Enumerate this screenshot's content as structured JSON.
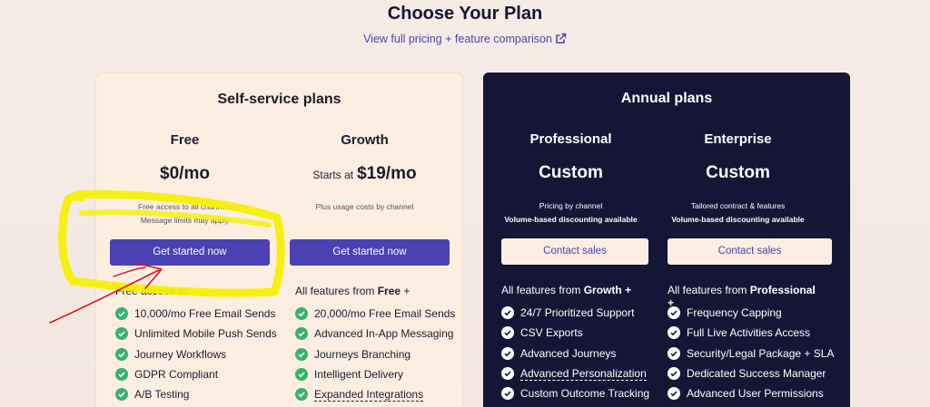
{
  "header": {
    "title": "Choose Your Plan",
    "compare_link": "View full pricing + feature comparison",
    "compare_icon": "external-link-icon"
  },
  "self_service": {
    "title": "Self-service plans",
    "plans": [
      {
        "name": "Free",
        "price_prefix": "",
        "price": "$0/mo",
        "desc_line1": "Free access to all channels",
        "desc_line2": "Message limits may apply",
        "button": "Get started now",
        "features_head_text": "Free access to:",
        "features_head_bold": "",
        "features": [
          "10,000/mo Free Email Sends",
          "Unlimited Mobile Push Sends",
          "Journey Workflows",
          "GDPR Compliant",
          "A/B Testing"
        ]
      },
      {
        "name": "Growth",
        "price_prefix": "Starts at",
        "price": "$19/mo",
        "desc_line1": "Plus usage costs by channel",
        "desc_line2": "",
        "button": "Get started now",
        "features_head_text": "All features from",
        "features_head_bold": "Free",
        "features_head_suffix": "+",
        "features": [
          "20,000/mo Free Email Sends",
          "Advanced In-App Messaging",
          "Journeys Branching",
          "Intelligent Delivery",
          "Expanded Integrations"
        ]
      }
    ]
  },
  "annual": {
    "title": "Annual plans",
    "plans": [
      {
        "name": "Professional",
        "price": "Custom",
        "desc_line1": "Pricing by channel",
        "desc_line2": "Volume-based discounting available",
        "button": "Contact sales",
        "features_head_text": "All features from",
        "features_head_bold": "Growth",
        "features_head_suffix": "+",
        "features": [
          "24/7 Prioritized Support",
          "CSV Exports",
          "Advanced Journeys",
          "Advanced Personalization",
          "Custom Outcome Tracking"
        ]
      },
      {
        "name": "Enterprise",
        "price": "Custom",
        "desc_line1": "Tailored contract & features",
        "desc_line2": "Volume-based discounting available",
        "button": "Contact sales",
        "features_head_text": "All features from",
        "features_head_bold": "Professional",
        "features_head_suffix": "+",
        "features": [
          "Frequency Capping",
          "Full Live Activities Access",
          "Security/Legal Package + SLA",
          "Dedicated Success Manager",
          "Advanced User Permissions"
        ]
      }
    ]
  },
  "colors": {
    "accent": "#4a41b4",
    "check_green": "#38b36b",
    "dark_card": "#151536",
    "highlight": "#f5f000",
    "annotation_red": "#e0101a"
  }
}
